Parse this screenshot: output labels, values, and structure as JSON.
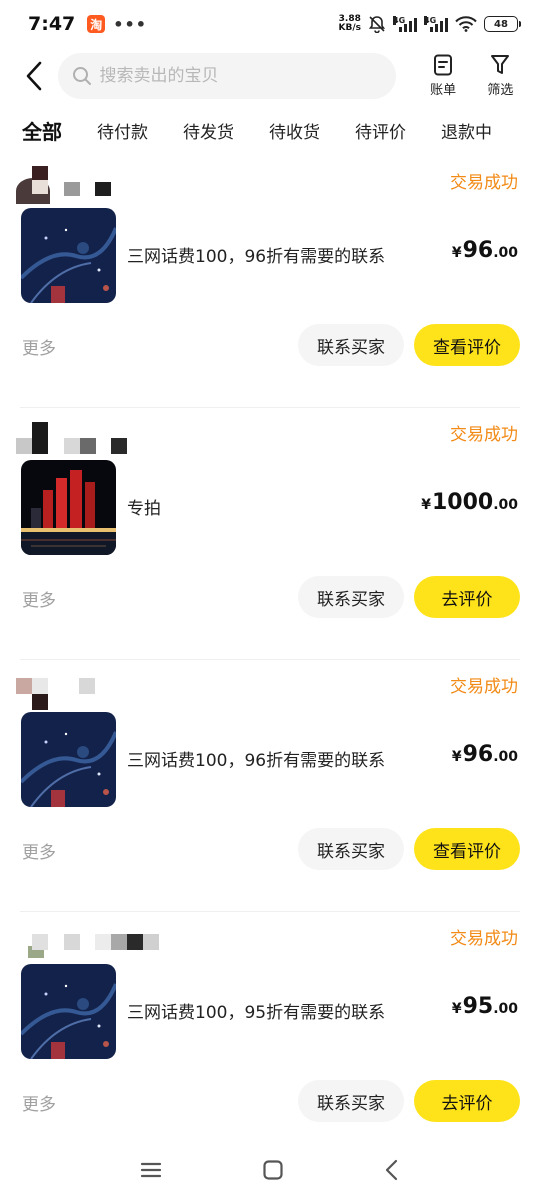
{
  "status_bar": {
    "time": "7:47",
    "app_badge": "淘",
    "dots": "•••",
    "net_speed_value": "3.88",
    "net_speed_unit": "KB/s",
    "signal_1_label": "4G",
    "signal_2_label": "4G",
    "battery": "48"
  },
  "header": {
    "search_placeholder": "搜索卖出的宝贝",
    "bill_label": "账单",
    "filter_label": "筛选"
  },
  "tabs": [
    {
      "label": "全部",
      "active": true
    },
    {
      "label": "待付款",
      "active": false
    },
    {
      "label": "待发货",
      "active": false
    },
    {
      "label": "待收货",
      "active": false
    },
    {
      "label": "待评价",
      "active": false
    },
    {
      "label": "退款中",
      "active": false
    }
  ],
  "orders": [
    {
      "status": "交易成功",
      "title": "三网话费100，96折有需要的联系",
      "price_symbol": "¥",
      "price_int": "96",
      "price_dec": ".00",
      "more": "更多",
      "contact_btn": "联系买家",
      "action_btn": "查看评价"
    },
    {
      "status": "交易成功",
      "title": "专拍",
      "price_symbol": "¥",
      "price_int": "1000",
      "price_dec": ".00",
      "more": "更多",
      "contact_btn": "联系买家",
      "action_btn": "去评价"
    },
    {
      "status": "交易成功",
      "title": "三网话费100，96折有需要的联系",
      "price_symbol": "¥",
      "price_int": "96",
      "price_dec": ".00",
      "more": "更多",
      "contact_btn": "联系买家",
      "action_btn": "查看评价"
    },
    {
      "status": "交易成功",
      "title": "三网话费100，95折有需要的联系",
      "price_symbol": "¥",
      "price_int": "95",
      "price_dec": ".00",
      "more": "更多",
      "contact_btn": "联系买家",
      "action_btn": "去评价"
    }
  ],
  "colors": {
    "accent_yellow": "#ffe31a",
    "status_orange": "#f28a16"
  }
}
